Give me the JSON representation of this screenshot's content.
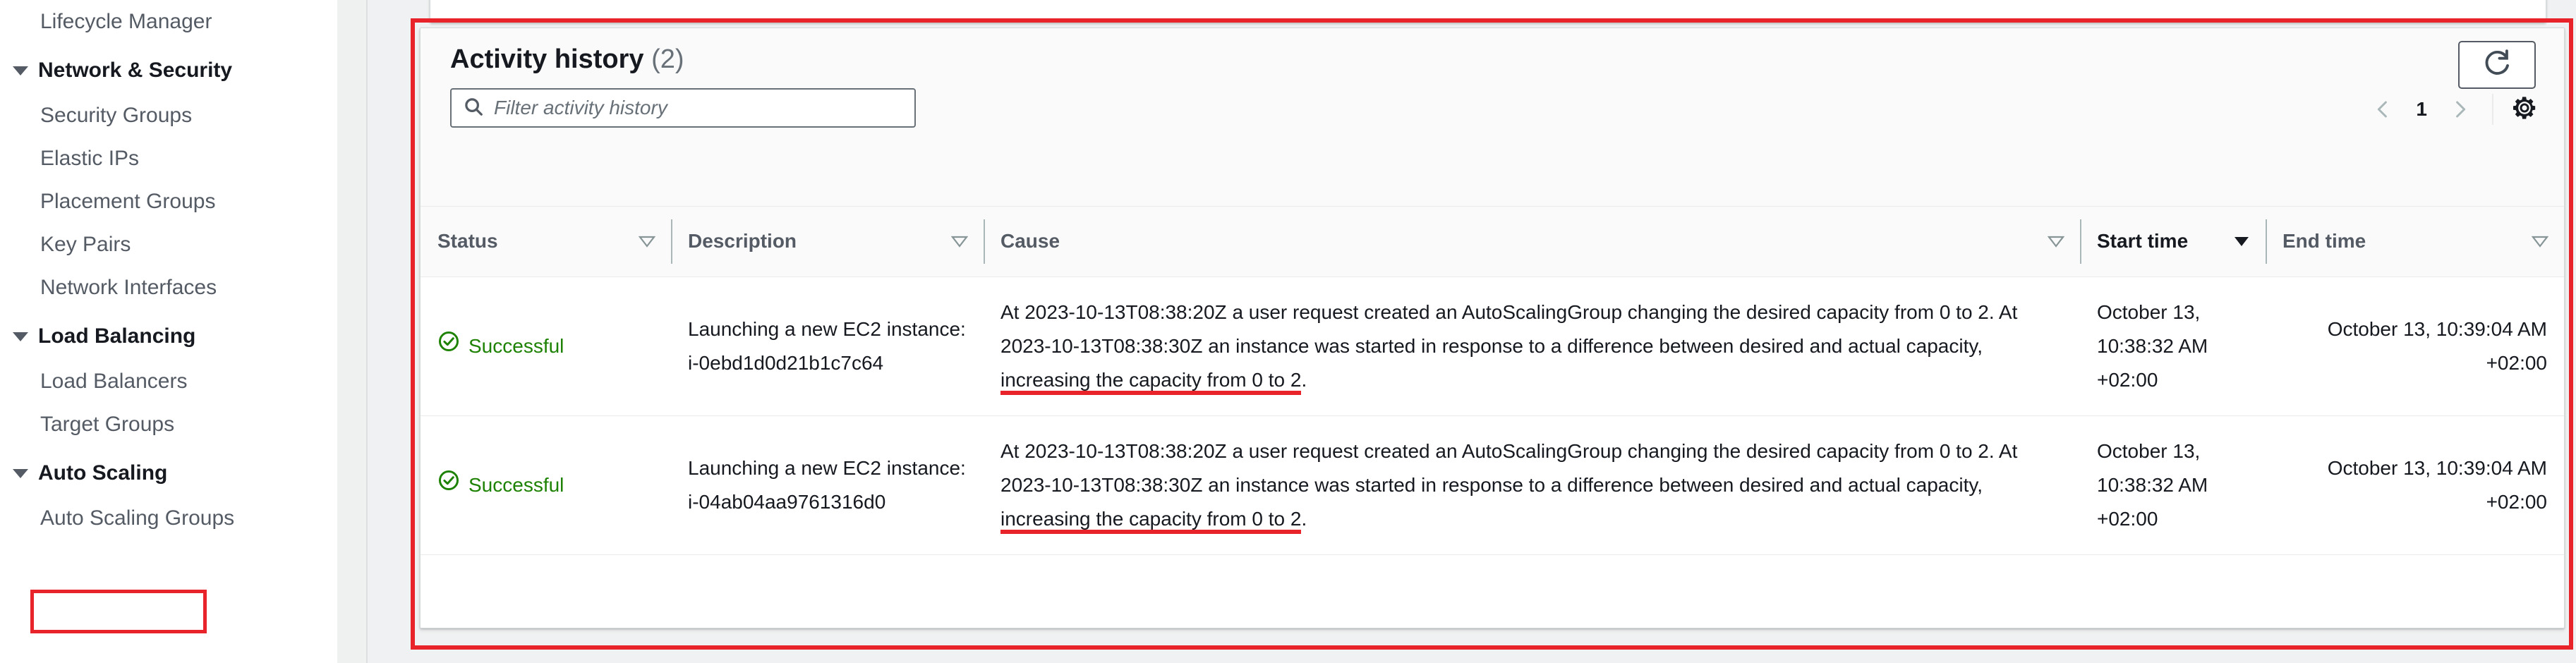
{
  "sidebar": {
    "items": [
      {
        "label": "Lifecycle Manager",
        "type": "leaf"
      },
      {
        "label": "Network & Security",
        "type": "group"
      },
      {
        "label": "Security Groups",
        "type": "leaf"
      },
      {
        "label": "Elastic IPs",
        "type": "leaf"
      },
      {
        "label": "Placement Groups",
        "type": "leaf"
      },
      {
        "label": "Key Pairs",
        "type": "leaf"
      },
      {
        "label": "Network Interfaces",
        "type": "leaf"
      },
      {
        "label": "Load Balancing",
        "type": "group"
      },
      {
        "label": "Load Balancers",
        "type": "leaf"
      },
      {
        "label": "Target Groups",
        "type": "leaf"
      },
      {
        "label": "Auto Scaling",
        "type": "group"
      },
      {
        "label": "Auto Scaling Groups",
        "type": "leaf",
        "highlighted": true
      }
    ]
  },
  "panel": {
    "title": "Activity history",
    "count": "(2)",
    "refresh_label": "refresh-icon",
    "filter": {
      "placeholder": "Filter activity history",
      "value": ""
    },
    "pagination": {
      "prev_label": "‹",
      "page": "1",
      "next_label": "›"
    },
    "settings_label": "gear-icon"
  },
  "table": {
    "columns": [
      {
        "label": "Status",
        "sortable": true,
        "sorted": false
      },
      {
        "label": "Description",
        "sortable": true,
        "sorted": false
      },
      {
        "label": "Cause",
        "sortable": true,
        "sorted": false
      },
      {
        "label": "Start time",
        "sortable": true,
        "sorted": true
      },
      {
        "label": "End time",
        "sortable": true,
        "sorted": false
      }
    ],
    "rows": [
      {
        "status": "Successful",
        "status_color": "#1d8102",
        "description": "Launching a new EC2 instance: i-0ebd1d0d21b1c7c64",
        "cause_before": "At 2023-10-13T08:38:20Z a user request created an AutoScalingGroup changing the desired capacity from 0 to 2. At 2023-10-13T08:38:30Z an instance was started in response to a difference between desired and actual capacity, ",
        "cause_highlight": "increasing the capacity from 0 to 2",
        "cause_after": ".",
        "start_time": "October 13, 10:38:32 AM +02:00",
        "end_time": "October 13, 10:39:04 AM +02:00"
      },
      {
        "status": "Successful",
        "status_color": "#1d8102",
        "description": "Launching a new EC2 instance: i-04ab04aa9761316d0",
        "cause_before": "At 2023-10-13T08:38:20Z a user request created an AutoScalingGroup changing the desired capacity from 0 to 2. At 2023-10-13T08:38:30Z an instance was started in response to a difference between desired and actual capacity, ",
        "cause_highlight": "increasing the capacity from 0 to 2",
        "cause_after": ".",
        "start_time": "October 13, 10:38:32 AM +02:00",
        "end_time": "October 13, 10:39:04 AM +02:00"
      }
    ]
  },
  "colors": {
    "annotation": "#e8232a",
    "success": "#1d8102",
    "header_text": "#545b64",
    "panel_bg": "#fafafa"
  }
}
